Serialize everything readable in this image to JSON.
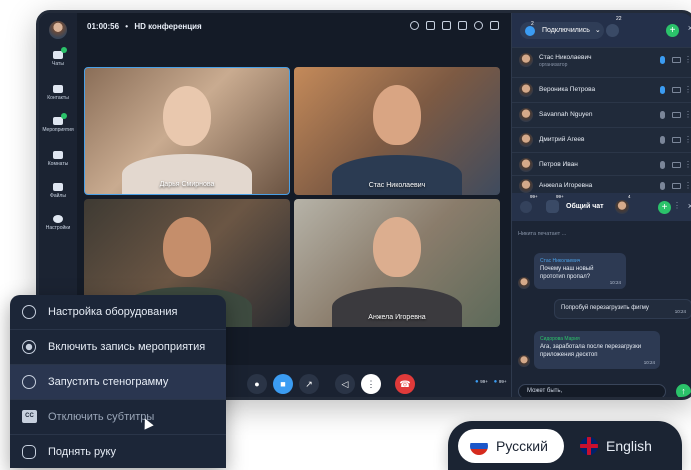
{
  "rail": {
    "items": [
      {
        "label": "Чаты"
      },
      {
        "label": "Контакты"
      },
      {
        "label": "Мероприятия"
      },
      {
        "label": "Комнаты"
      },
      {
        "label": "Файлы"
      },
      {
        "label": "Настройки"
      }
    ]
  },
  "topbar": {
    "time": "01:00:56",
    "sep": "•",
    "title": "HD конференция"
  },
  "video": {
    "tiles": [
      {
        "name": "Дарья Смирнова"
      },
      {
        "name": "Стас Николаевич"
      },
      {
        "name": ""
      },
      {
        "name": "Анжела Игоревна"
      }
    ]
  },
  "controls": {
    "participants_badge": "99+",
    "participants_badge2": "99+"
  },
  "panel": {
    "badge_count": "2",
    "connected_label": "Подключились",
    "badge_count2": "22",
    "participants": [
      {
        "name": "Стас Николаевич",
        "role": "организатор",
        "mic_on": true
      },
      {
        "name": "Вероника Петрова",
        "role": "",
        "mic_on": true
      },
      {
        "name": "Savannah Nguyen",
        "role": "",
        "mic_on": false
      },
      {
        "name": "Дмитрий Агеев",
        "role": "",
        "mic_on": false
      },
      {
        "name": "Петров Иван",
        "role": "",
        "mic_on": false
      },
      {
        "name": "Анжела Игоревна",
        "role": "",
        "mic_on": false
      }
    ],
    "chat": {
      "count1": "99+",
      "count2": "99+",
      "title": "Общий чат",
      "count3": "4",
      "typing": "Никита печатает ...",
      "messages": [
        {
          "author": "Стас Николаевич",
          "text_line1": "Почему наш новый",
          "text_line2": "прототип пропал?",
          "time": "10:24"
        },
        {
          "author": "",
          "text_line1": "Попробуй перезагрузить фигму",
          "text_line2": "",
          "time": "10:24"
        },
        {
          "author": "Сидорова Мария",
          "text_line1": "Ага, заработала после перезагрузки",
          "text_line2": "приложения десктоп",
          "time": "10:24"
        }
      ],
      "input_value": "Может быть,"
    }
  },
  "menu": {
    "items": [
      {
        "label": "Настройка оборудования"
      },
      {
        "label": "Включить запись мероприятия"
      },
      {
        "label": "Запустить стенограмму"
      },
      {
        "label": "Отключить субтитры"
      },
      {
        "label": "Поднять руку"
      }
    ],
    "cc_label": "CC"
  },
  "language": {
    "ru": "Русский",
    "en": "English"
  },
  "colors": {
    "accent_green": "#2bc26a",
    "accent_blue": "#3b9cf2",
    "hangup_red": "#e03a3a"
  }
}
